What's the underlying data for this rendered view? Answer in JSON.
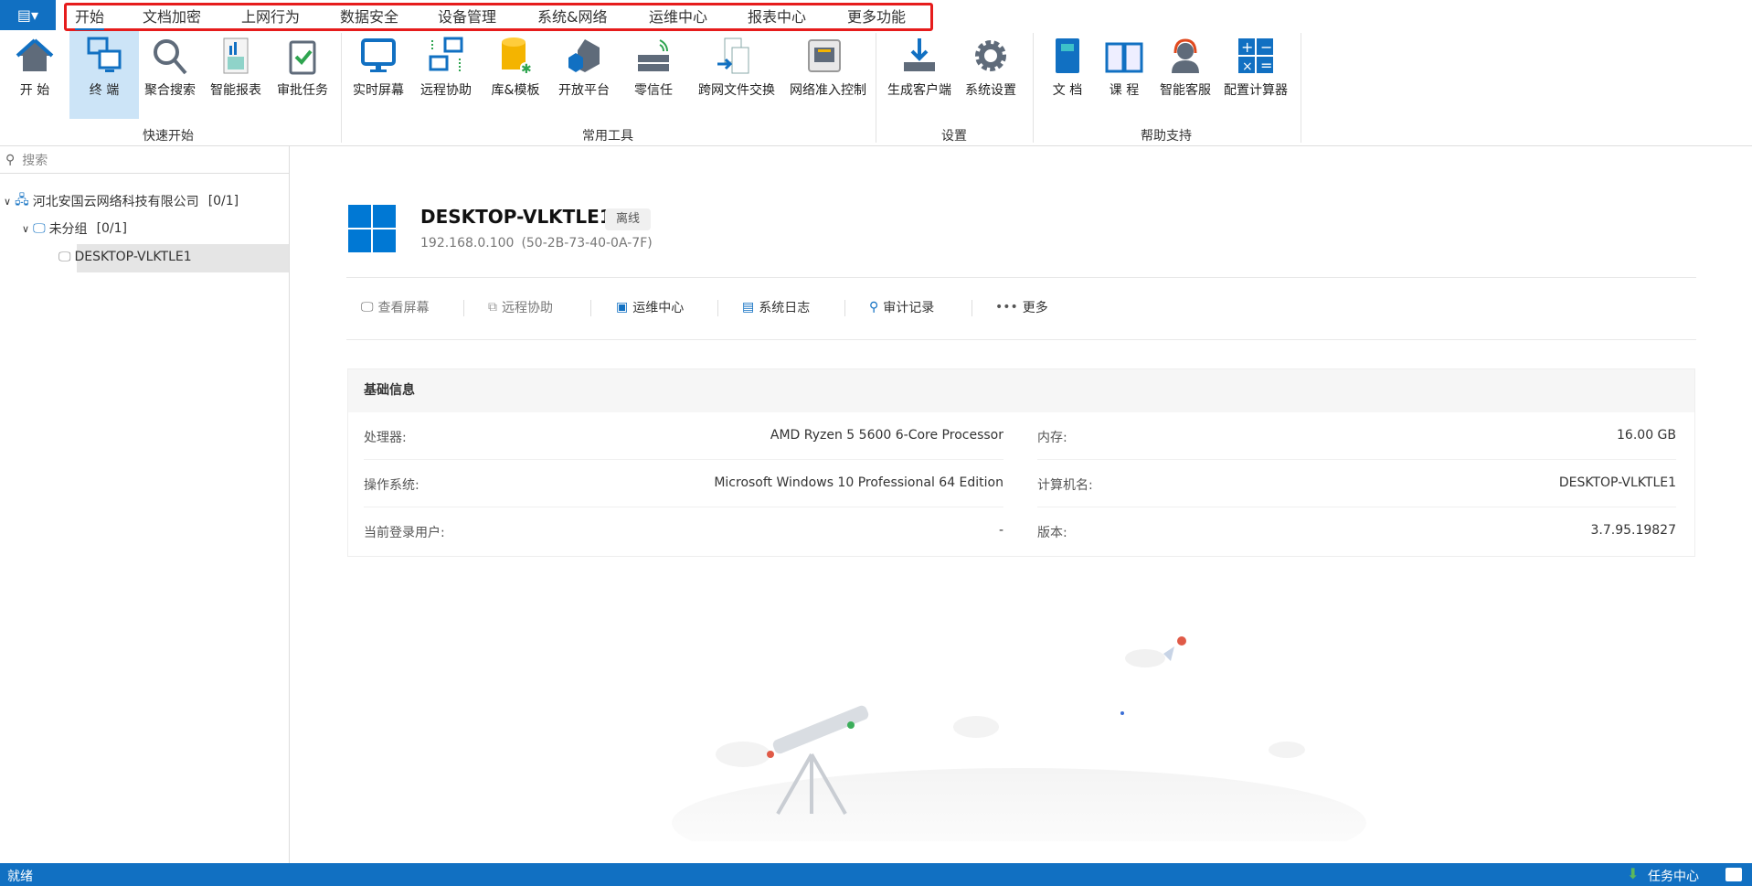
{
  "menu": {
    "app_icon": "menu-list-icon",
    "items": [
      "开始",
      "文档加密",
      "上网行为",
      "数据安全",
      "设备管理",
      "系统&网络",
      "运维中心",
      "报表中心",
      "更多功能"
    ],
    "active": "开始"
  },
  "ribbon": {
    "groups": [
      "快速开始",
      "常用工具",
      "设置",
      "帮助支持"
    ],
    "buttons": [
      "开 始",
      "终 端",
      "聚合搜索",
      "智能报表",
      "审批任务",
      "实时屏幕",
      "远程协助",
      "库&模板",
      "开放平台",
      "零信任",
      "跨网文件交换",
      "网络准入控制",
      "生成客户端",
      "系统设置",
      "文 档",
      "课 程",
      "智能客服",
      "配置计算器"
    ]
  },
  "sidebar": {
    "search_placeholder": "搜索",
    "tree": [
      {
        "label": "河北安国云网络科技有限公司",
        "count": "[0/1]"
      },
      {
        "label": "未分组",
        "count": "[0/1]"
      },
      {
        "label": "DESKTOP-VLKTLE1"
      }
    ]
  },
  "device": {
    "name": "DESKTOP-VLKTLE1",
    "status": "离线",
    "ip": "192.168.0.100",
    "mac": "(50-2B-73-40-0A-7F)"
  },
  "actions": [
    "查看屏幕",
    "远程协助",
    "运维中心",
    "系统日志",
    "审计记录",
    "更多"
  ],
  "info": {
    "title": "基础信息",
    "rows": [
      {
        "label": "处理器:",
        "value": "AMD Ryzen 5 5600 6-Core Processor",
        "label2": "内存:",
        "value2": "16.00 GB"
      },
      {
        "label": "操作系统:",
        "value": "Microsoft Windows 10 Professional 64 Edition",
        "label2": "计算机名:",
        "value2": "DESKTOP-VLKTLE1"
      },
      {
        "label": "当前登录用户:",
        "value": "-",
        "label2": "版本:",
        "value2": "3.7.95.19827"
      }
    ]
  },
  "status": {
    "left": "就绪",
    "task_center": "任务中心"
  },
  "colors": {
    "accent": "#1170c2",
    "highlight": "#e61c1c"
  }
}
